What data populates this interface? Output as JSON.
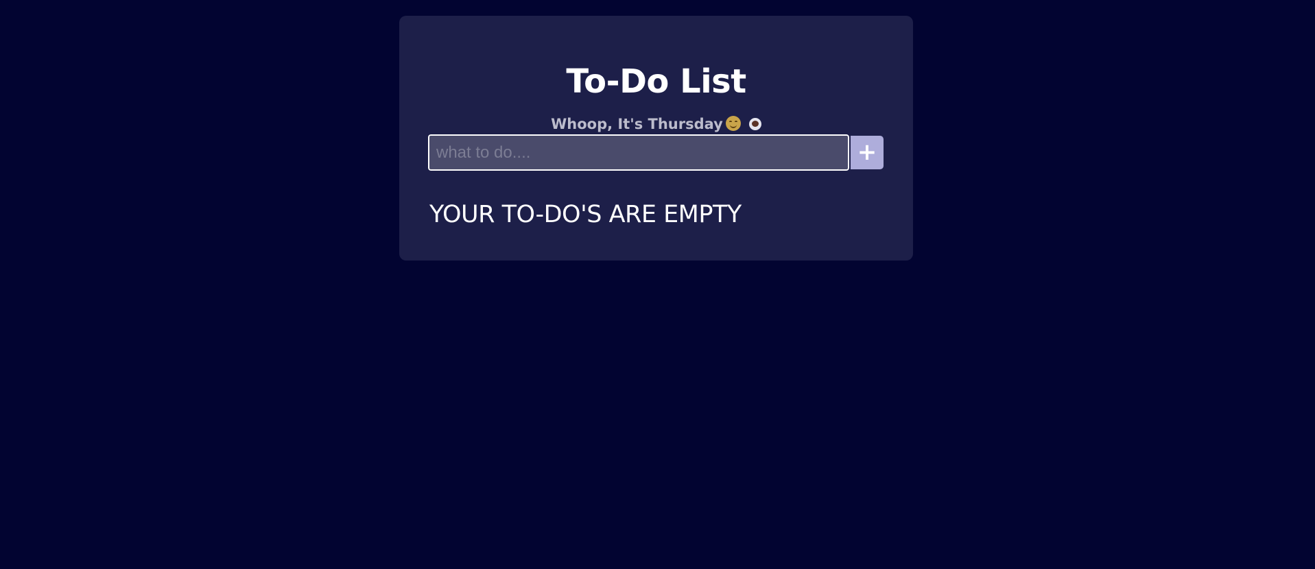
{
  "app": {
    "title": "To-Do List",
    "subtitle": "Whoop, It's Thursday",
    "subtitle_emojis": [
      "smiling-face-icon",
      "coffee-icon"
    ]
  },
  "form": {
    "input_value": "",
    "input_placeholder": "what to do....",
    "add_button_label": "+"
  },
  "list": {
    "items": [],
    "empty_message": "YOUR TO-DO'S ARE EMPTY"
  },
  "colors": {
    "background": "#020431",
    "card": "#1d1f49",
    "input_bg": "#4a4b6b",
    "accent": "#aeaddb",
    "text": "#ffffff",
    "muted_text": "#bcbccc"
  }
}
